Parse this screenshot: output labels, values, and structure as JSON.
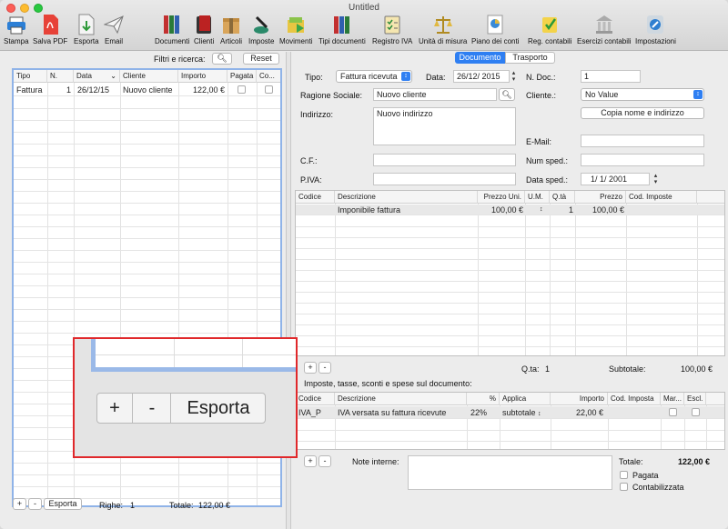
{
  "window": {
    "title": "Untitled"
  },
  "toolbar_left": [
    {
      "label": "Stampa",
      "icon": "printer-icon"
    },
    {
      "label": "Salva PDF",
      "icon": "pdf-icon"
    },
    {
      "label": "Esporta",
      "icon": "export-icon"
    },
    {
      "label": "Email",
      "icon": "email-icon"
    }
  ],
  "toolbar_right": [
    {
      "label": "Documenti",
      "icon": "documents-icon"
    },
    {
      "label": "Clienti",
      "icon": "clients-icon"
    },
    {
      "label": "Articoli",
      "icon": "articles-icon"
    },
    {
      "label": "Imposte",
      "icon": "taxes-icon"
    },
    {
      "label": "Movimenti",
      "icon": "movements-icon"
    },
    {
      "label": "Tipi documenti",
      "icon": "document-types-icon"
    },
    {
      "label": "Registro IVA",
      "icon": "vat-register-icon"
    },
    {
      "label": "Unità di misura",
      "icon": "units-icon"
    },
    {
      "label": "Piano dei conti",
      "icon": "chart-of-accounts-icon"
    },
    {
      "label": "Reg. contabili",
      "icon": "accounting-entries-icon"
    },
    {
      "label": "Esercizi contabili",
      "icon": "fiscal-years-icon"
    },
    {
      "label": "Impostazioni",
      "icon": "settings-icon"
    }
  ],
  "filter": {
    "label": "Filtri e ricerca:",
    "reset": "Reset"
  },
  "doc_list": {
    "columns": [
      "Tipo",
      "N.",
      "Data",
      "Cliente",
      "Importo",
      "Pagata",
      "Co..."
    ],
    "rows": [
      {
        "tipo": "Fattura",
        "n": "1",
        "data": "26/12/15",
        "cliente": "Nuovo cliente",
        "importo": "122,00 €"
      }
    ]
  },
  "footer_left": {
    "plus": "+",
    "minus": "-",
    "export": "Esporta",
    "rows_label": "Righe:",
    "rows_value": "1",
    "total_label": "Totale:",
    "total_value": "122,00 €"
  },
  "tabs": {
    "documento": "Documento",
    "trasporto": "Trasporto"
  },
  "form": {
    "tipo_label": "Tipo:",
    "tipo_value": "Fattura ricevuta",
    "data_label": "Data:",
    "data_value": "26/12/ 2015",
    "ndoc_label": "N. Doc.:",
    "ndoc_value": "1",
    "ragione_label": "Ragione Sociale:",
    "ragione_value": "Nuovo cliente",
    "cliente_label": "Cliente.:",
    "cliente_value": "No Value",
    "indirizzo_label": "Indirizzo:",
    "indirizzo_value": "Nuovo indirizzo",
    "copia_button": "Copia nome e indirizzo",
    "email_label": "E-Mail:",
    "cf_label": "C.F.:",
    "numsped_label": "Num sped.:",
    "piva_label": "P.IVA:",
    "datasped_label": "Data sped.:",
    "datasped_value": "1/  1/ 2001"
  },
  "lines": {
    "columns": [
      "Codice",
      "Descrizione",
      "Prezzo Uni.",
      "U.M.",
      "Q.tà",
      "Prezzo",
      "Cod. Imposte"
    ],
    "rows": [
      {
        "codice": "",
        "descrizione": "Imponibile fattura",
        "prezzo_uni": "100,00 €",
        "um": "",
        "qta": "1",
        "prezzo": "100,00 €",
        "cod": ""
      }
    ]
  },
  "lines_footer": {
    "plus": "+",
    "minus": "-",
    "qta_label": "Q.ta:",
    "qta_value": "1",
    "subtotal_label": "Subtotale:",
    "subtotal_value": "100,00 €"
  },
  "taxes": {
    "heading": "Imposte, tasse, sconti e spese sul documento:",
    "columns": [
      "Codice",
      "Descrizione",
      "%",
      "Applica",
      "Importo",
      "Cod. Imposta",
      "Mar...",
      "Escl."
    ],
    "rows": [
      {
        "codice": "IVA_P",
        "descrizione": "IVA versata su fattura ricevute",
        "perc": "22%",
        "applica": "subtotale",
        "importo": "22,00 €"
      }
    ]
  },
  "bottom": {
    "plus": "+",
    "minus": "-",
    "note_label": "Note interne:",
    "total_label": "Totale:",
    "total_value": "122,00 €",
    "pagata": "Pagata",
    "contabilizzata": "Contabilizzata"
  },
  "zoom": {
    "plus": "+",
    "minus": "-",
    "export": "Esporta"
  },
  "colors": {
    "accent": "#2f7ff2",
    "highlight": "#e0282b"
  }
}
